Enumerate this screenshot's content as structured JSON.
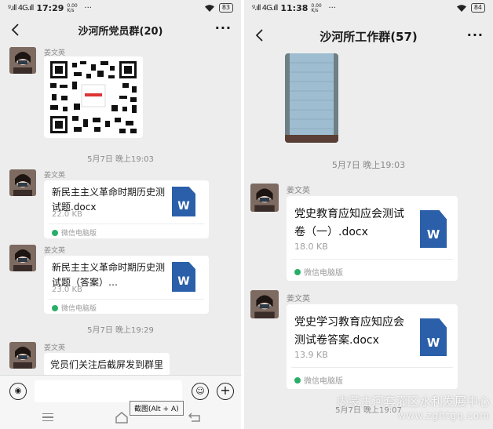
{
  "left": {
    "status": {
      "signal": "ᵍ.ıll 4G.ıll",
      "time": "17:29",
      "speed": "0.00 K/s",
      "dots": "···",
      "wifi": "wifi",
      "battery": "83"
    },
    "title": "沙河所党员群(20)",
    "more": "···",
    "messages": [
      {
        "sender": "姜文英",
        "type": "image"
      },
      {
        "timestamp": "5月7日 晚上19:03"
      },
      {
        "sender": "姜文英",
        "type": "file",
        "name": "新民主主义革命时期历史测试题.docx",
        "size": "22.0 KB",
        "source": "微信电脑版"
      },
      {
        "sender": "姜文英",
        "type": "file",
        "name": "新民主主义革命时期历史测试题（答案）…",
        "size": "23.0 KB",
        "source": "微信电脑版"
      },
      {
        "timestamp": "5月7日 晚上19:29"
      },
      {
        "sender": "姜文英",
        "type": "text",
        "text": "党员们关注后截屏发到群里"
      }
    ],
    "input": {
      "placeholder": ""
    },
    "tooltip": "截图(Alt + A)"
  },
  "right": {
    "status": {
      "signal": "ᵍ.ıll 4G.ıll",
      "time": "11:38",
      "speed": "0.00 K/s",
      "dots": "···",
      "wifi": "wifi",
      "battery": "84"
    },
    "title": "沙河所工作群(57)",
    "more": "···",
    "messages": [
      {
        "type": "image"
      },
      {
        "timestamp": "5月7日 晚上19:03"
      },
      {
        "sender": "姜文英",
        "type": "file",
        "name": "党史教育应知应会测试卷（一）.docx",
        "size": "18.0 KB",
        "source": "微信电脑版"
      },
      {
        "sender": "姜文英",
        "type": "file",
        "name": "党史学习教育应知应会测试卷答案.docx",
        "size": "13.9 KB",
        "source": "微信电脑版"
      },
      {
        "timestamp": "5月7日 晚上19:07"
      }
    ]
  },
  "watermark": {
    "line1": "内蒙古河套灌区水利发展中心",
    "line2": "www.zghtgq.com"
  },
  "word_icon_letter": "W",
  "colors": {
    "chat_bg": "#ededed",
    "word_blue": "#2b5fa9",
    "source_green": "#2aae67"
  }
}
